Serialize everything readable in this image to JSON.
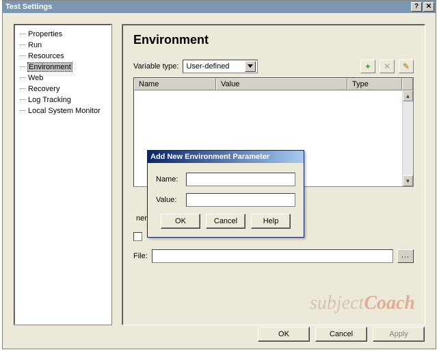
{
  "window": {
    "title": "Test Settings"
  },
  "tree": {
    "items": [
      {
        "label": "Properties"
      },
      {
        "label": "Run"
      },
      {
        "label": "Resources"
      },
      {
        "label": "Environment",
        "selected": true
      },
      {
        "label": "Web"
      },
      {
        "label": "Recovery"
      },
      {
        "label": "Log Tracking"
      },
      {
        "label": "Local System Monitor"
      }
    ]
  },
  "main": {
    "heading": "Environment",
    "variable_type_label": "Variable type:",
    "variable_type_value": "User-defined",
    "toolbar": {
      "add_icon": "+",
      "delete_icon": "✕",
      "edit_icon": "✎"
    },
    "table": {
      "headers": {
        "name": "Name",
        "value": "Value",
        "type": "Type"
      }
    },
    "export_text_suffix": "nent variables to an XML file",
    "file_label": "File:",
    "file_value": "",
    "browse_label": "..."
  },
  "modal": {
    "title": "Add New Environment Parameter",
    "name_label": "Name:",
    "name_value": "",
    "value_label": "Value:",
    "value_value": "",
    "ok": "OK",
    "cancel": "Cancel",
    "help": "Help"
  },
  "buttons": {
    "ok": "OK",
    "cancel": "Cancel",
    "apply": "Apply"
  },
  "watermark_a": "subject",
  "watermark_b": "Coach"
}
